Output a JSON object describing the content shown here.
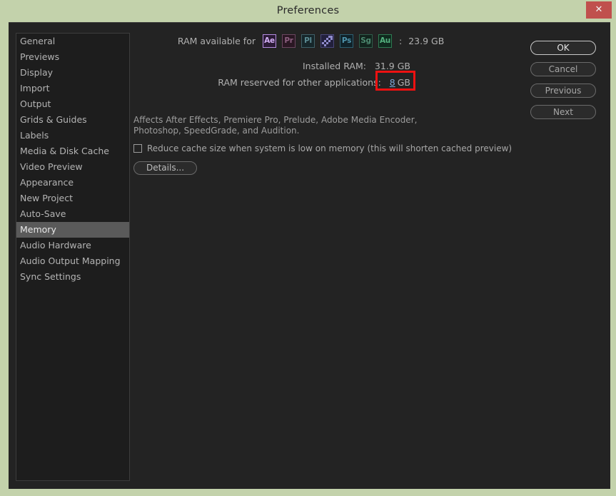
{
  "window": {
    "title": "Preferences",
    "close_label": "✕",
    "titlebar_color": "#c3d2ab",
    "close_color": "#c0504d",
    "body_color": "#232323"
  },
  "sidebar": {
    "selected": "Memory",
    "items": [
      {
        "label": "General"
      },
      {
        "label": "Previews"
      },
      {
        "label": "Display"
      },
      {
        "label": "Import"
      },
      {
        "label": "Output"
      },
      {
        "label": "Grids & Guides"
      },
      {
        "label": "Labels"
      },
      {
        "label": "Media & Disk Cache"
      },
      {
        "label": "Video Preview"
      },
      {
        "label": "Appearance"
      },
      {
        "label": "New Project"
      },
      {
        "label": "Auto-Save"
      },
      {
        "label": "Memory"
      },
      {
        "label": "Audio Hardware"
      },
      {
        "label": "Audio Output Mapping"
      },
      {
        "label": "Sync Settings"
      }
    ]
  },
  "memory_panel": {
    "installed_ram_label": "Installed RAM:",
    "installed_ram_value": "31.9 GB",
    "reserved_label": "RAM reserved for other applications:",
    "reserved_value": "8",
    "reserved_unit": "GB",
    "reserved_highlight_color": "#ee1111",
    "available_label": "RAM available for",
    "available_colon": ":",
    "available_value": "23.9 GB",
    "app_icons": [
      {
        "name": "after-effects-icon",
        "abbr": "Ae",
        "enabled": true
      },
      {
        "name": "premiere-pro-icon",
        "abbr": "Pr",
        "enabled": false
      },
      {
        "name": "prelude-icon",
        "abbr": "Pl",
        "enabled": false
      },
      {
        "name": "adobe-media-encoder-icon",
        "abbr": "",
        "enabled": false
      },
      {
        "name": "photoshop-icon",
        "abbr": "Ps",
        "enabled": false
      },
      {
        "name": "speedgrade-icon",
        "abbr": "Sg",
        "enabled": false
      },
      {
        "name": "audition-icon",
        "abbr": "Au",
        "enabled": false
      }
    ],
    "affects_text": "Affects After Effects, Premiere Pro, Prelude, Adobe Media Encoder, Photoshop, SpeedGrade, and Audition.",
    "reduce_cache_label": "Reduce cache size when system is low on memory (this will shorten cached preview)",
    "reduce_cache_checked": false,
    "details_label": "Details..."
  },
  "buttons": {
    "ok": "OK",
    "cancel": "Cancel",
    "previous": "Previous",
    "next": "Next"
  }
}
